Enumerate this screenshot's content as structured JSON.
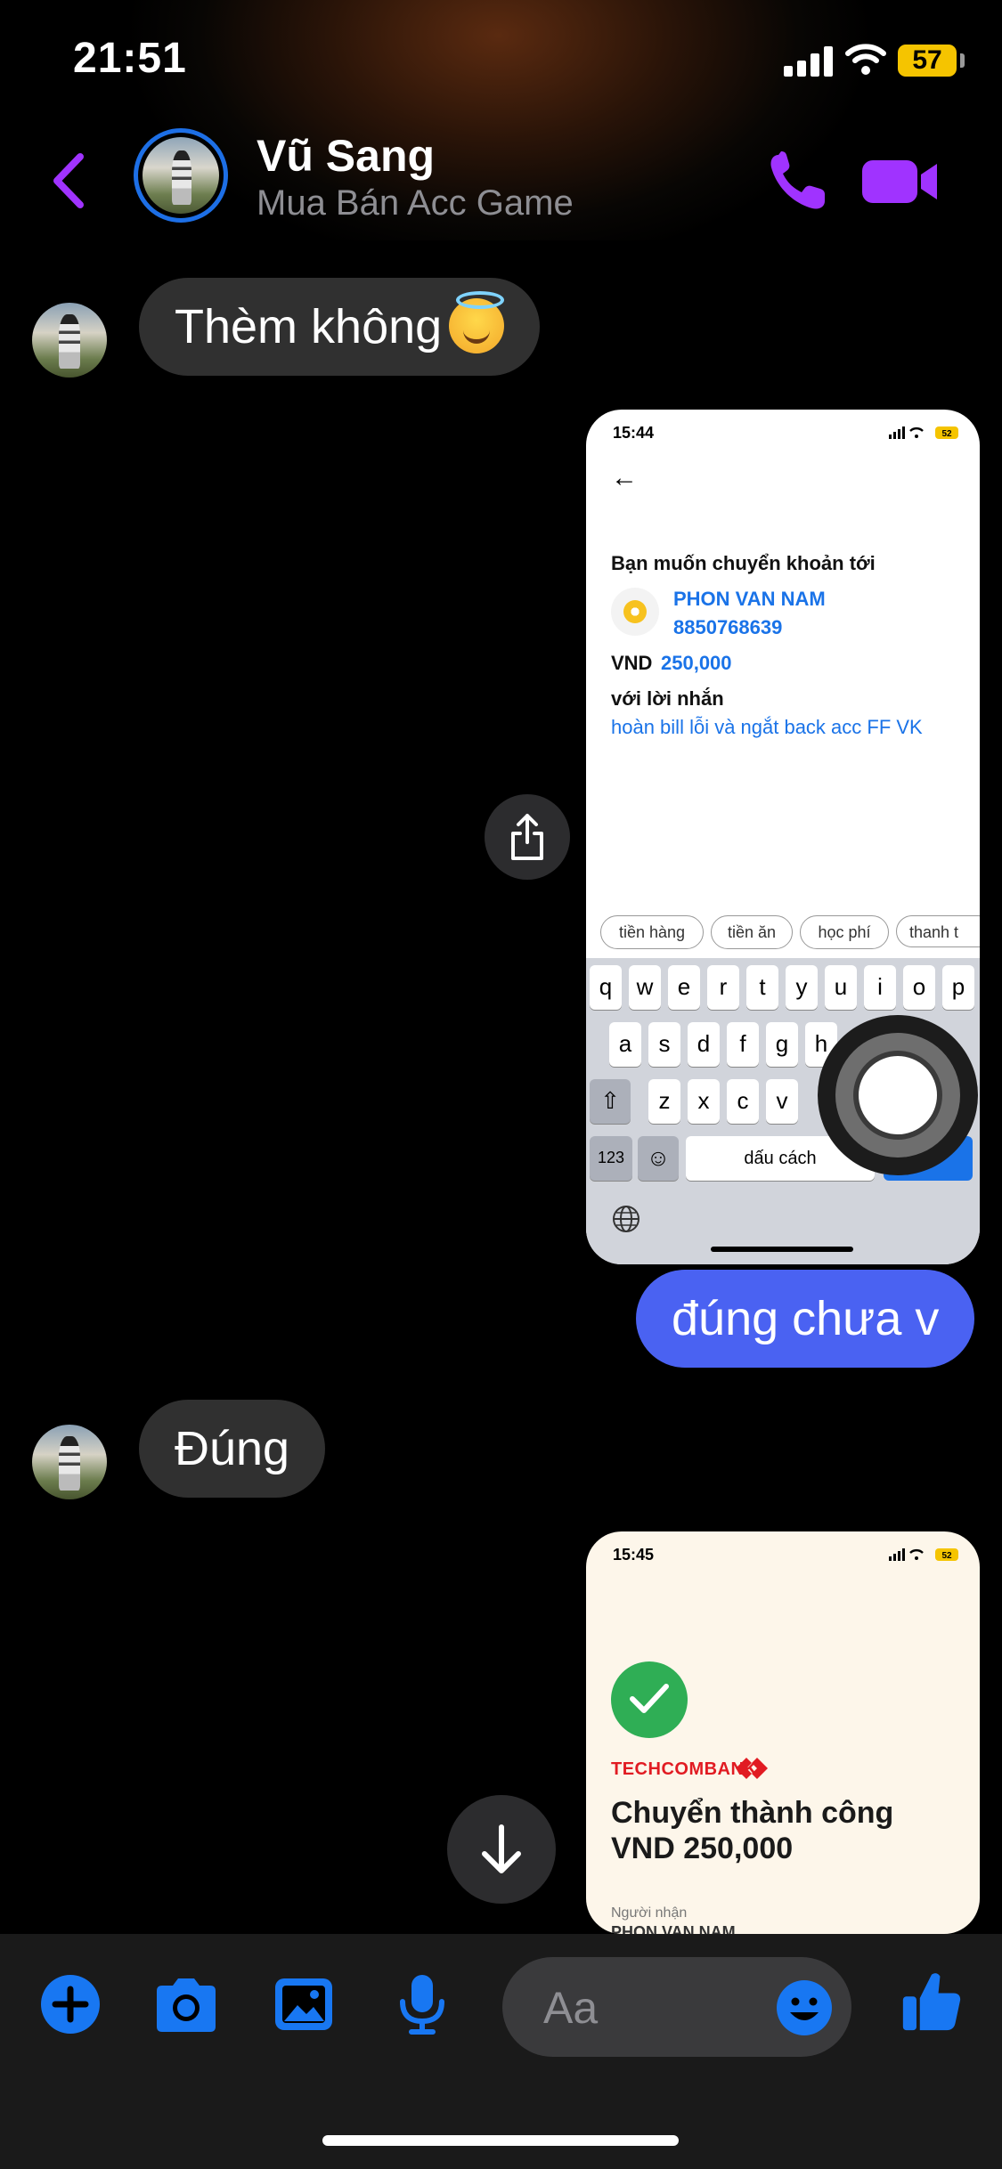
{
  "status_bar": {
    "time": "21:51",
    "battery": "57"
  },
  "header": {
    "name": "Vũ Sang",
    "subtitle": "Mua Bán Acc Game"
  },
  "messages": {
    "m1": "Thèm không",
    "m2_out": "đúng chưa v",
    "m3": "Đúng"
  },
  "screenshot1": {
    "time": "15:44",
    "battery": "52",
    "heading": "Bạn muốn chuyển khoản tới",
    "recipient_name": "PHON VAN NAM",
    "account_number": "8850768639",
    "currency": "VND",
    "amount": "250,000",
    "message_label": "với lời nhắn",
    "message_text": "hoàn bill lỗi và ngắt back acc FF VK",
    "chips": [
      "tiền hàng",
      "tiền ăn",
      "học phí",
      "thanh t"
    ],
    "keys_row1": [
      "q",
      "w",
      "e",
      "r",
      "t",
      "y",
      "u",
      "i",
      "o",
      "p"
    ],
    "keys_row2": [
      "a",
      "s",
      "d",
      "f",
      "g",
      "h"
    ],
    "keys_row3": [
      "z",
      "x",
      "c",
      "v"
    ],
    "key_123": "123",
    "space_label": "dấu cách"
  },
  "screenshot2": {
    "time": "15:45",
    "battery": "52",
    "bank": "TECHCOMBANK",
    "title_line1": "Chuyển thành công",
    "title_line2": "VND 250,000",
    "recipient_label": "Người nhận",
    "recipient_name": "PHON VAN NAM"
  },
  "composer": {
    "placeholder": "Aa"
  },
  "colors": {
    "accent_purple": "#a033ff",
    "accent_blue": "#1877f2",
    "bubble_out": "#4a62f2",
    "bubble_in": "#303030"
  }
}
